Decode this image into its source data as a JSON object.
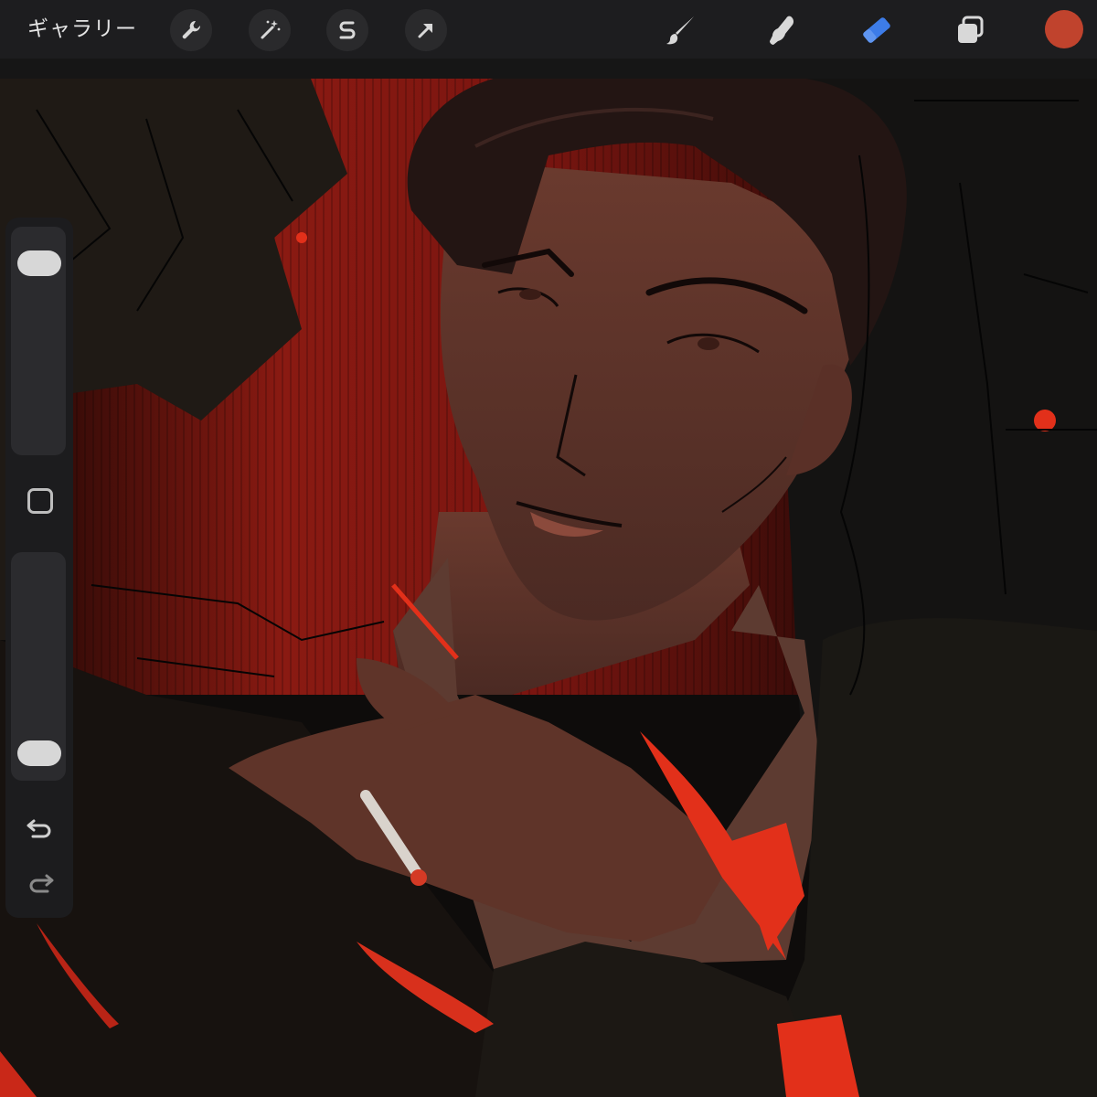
{
  "toolbar": {
    "gallery_label": "ギャラリー",
    "left_tools": [
      {
        "name": "actions",
        "icon": "wrench-icon"
      },
      {
        "name": "adjustments",
        "icon": "magic-wand-icon"
      },
      {
        "name": "selection",
        "icon": "selection-s-icon"
      },
      {
        "name": "transform",
        "icon": "arrow-cursor-icon"
      }
    ],
    "right_tools": [
      {
        "name": "brush",
        "icon": "brush-icon",
        "active": false
      },
      {
        "name": "smudge",
        "icon": "smudge-finger-icon",
        "active": false
      },
      {
        "name": "eraser",
        "icon": "eraser-icon",
        "active": true
      },
      {
        "name": "layers",
        "icon": "layers-icon",
        "active": false
      }
    ],
    "current_color": "#c0432d",
    "active_color": "#3d7ce8"
  },
  "sidebar": {
    "brush_size_level": 0.9,
    "opacity_level": 0.05,
    "modifier_icon": "square-icon",
    "undo_icon": "undo-arrow-icon",
    "redo_icon": "redo-arrow-icon"
  },
  "colors": {
    "background_red": "#7a1510",
    "skin": "#5a3027",
    "hair": "#231513",
    "accent_red": "#e2301a"
  }
}
